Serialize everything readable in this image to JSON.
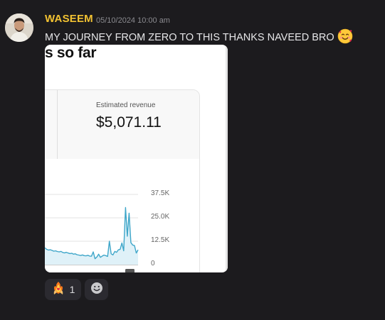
{
  "message": {
    "author": "WASEEM",
    "timestamp": "05/10/2024 10:00 am",
    "text": "MY JOURNEY FROM ZERO TO THIS THANKS NAVEED BRO",
    "text_emoji": "smiling-face-with-hearts-icon"
  },
  "attachment": {
    "title_fragment": "s so far",
    "revenue_label": "Estimated revenue",
    "revenue_value": "$5,071.11",
    "chart_color": "#3ea6c9"
  },
  "chart_data": {
    "type": "line",
    "title": "",
    "xlabel": "",
    "ylabel": "",
    "ylim": [
      0,
      37500
    ],
    "y_ticks": [
      "37.5K",
      "25.0K",
      "12.5K",
      "0"
    ],
    "series": [
      {
        "values": [
          9000,
          8200,
          7800,
          8000,
          7600,
          7200,
          7400,
          7000,
          6800,
          7100,
          6500,
          6300,
          6600,
          6200,
          5900,
          6100,
          5600,
          5800,
          5300,
          5100,
          4900,
          5200,
          4800,
          4700,
          5000,
          4600,
          4500,
          6800,
          3200,
          4100,
          5600,
          3900,
          4600,
          5100,
          4800,
          4400,
          12500,
          5800,
          5200,
          7100,
          6600,
          7900,
          8200,
          11600,
          7400,
          30500,
          15200,
          27500,
          11800,
          10500,
          10200,
          6200,
          7900
        ]
      }
    ]
  },
  "reactions": [
    {
      "emoji": "hands-with-heart-fire-icon",
      "count": "1"
    },
    {
      "emoji": "add-reaction-smiley-icon",
      "count": ""
    }
  ]
}
